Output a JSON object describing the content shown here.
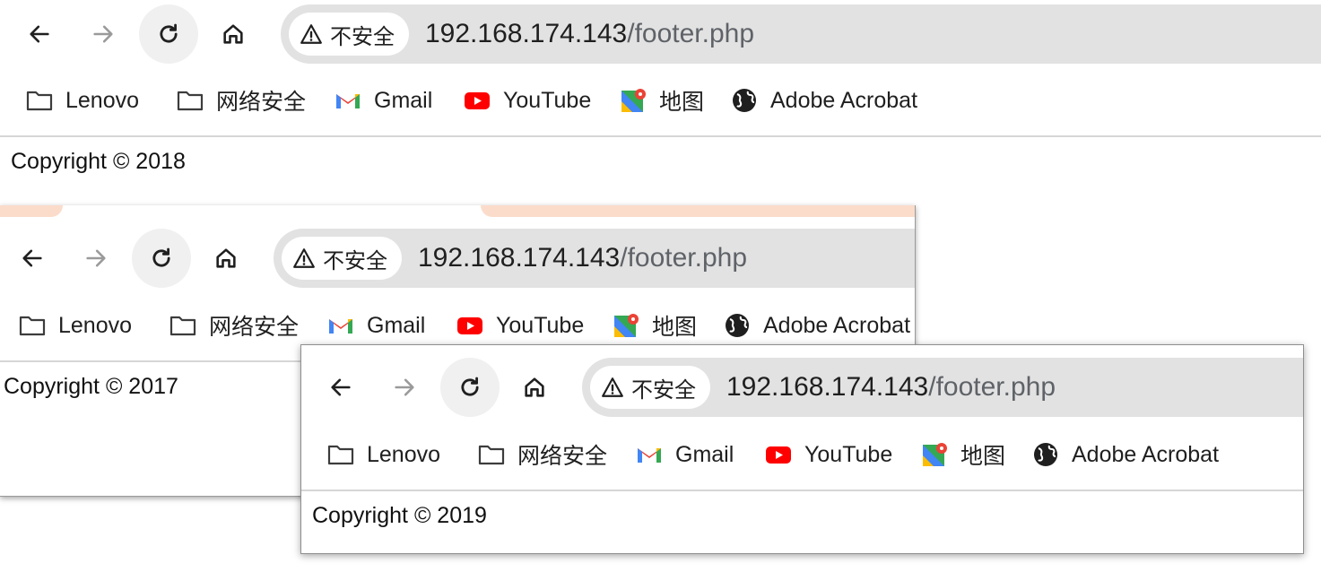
{
  "url": {
    "host": "192.168.174.143",
    "path": "/footer.php"
  },
  "security_chip": {
    "label": "不安全"
  },
  "bookmarks": [
    {
      "label": "Lenovo",
      "icon": "folder-icon"
    },
    {
      "label": "网络安全",
      "icon": "folder-icon"
    },
    {
      "label": "Gmail",
      "icon": "gmail-icon"
    },
    {
      "label": "YouTube",
      "icon": "youtube-icon"
    },
    {
      "label": "地图",
      "icon": "maps-icon"
    },
    {
      "label": "Adobe Acrobat",
      "icon": "globe-icon"
    }
  ],
  "windows": [
    {
      "copyright": "Copyright © 2018"
    },
    {
      "copyright": "Copyright © 2017"
    },
    {
      "copyright": "Copyright © 2019"
    }
  ],
  "colors": {
    "tab_accent": "#fbdccb",
    "omnibox_bg": "#e2e2e2",
    "youtube_red": "#ff0000"
  }
}
